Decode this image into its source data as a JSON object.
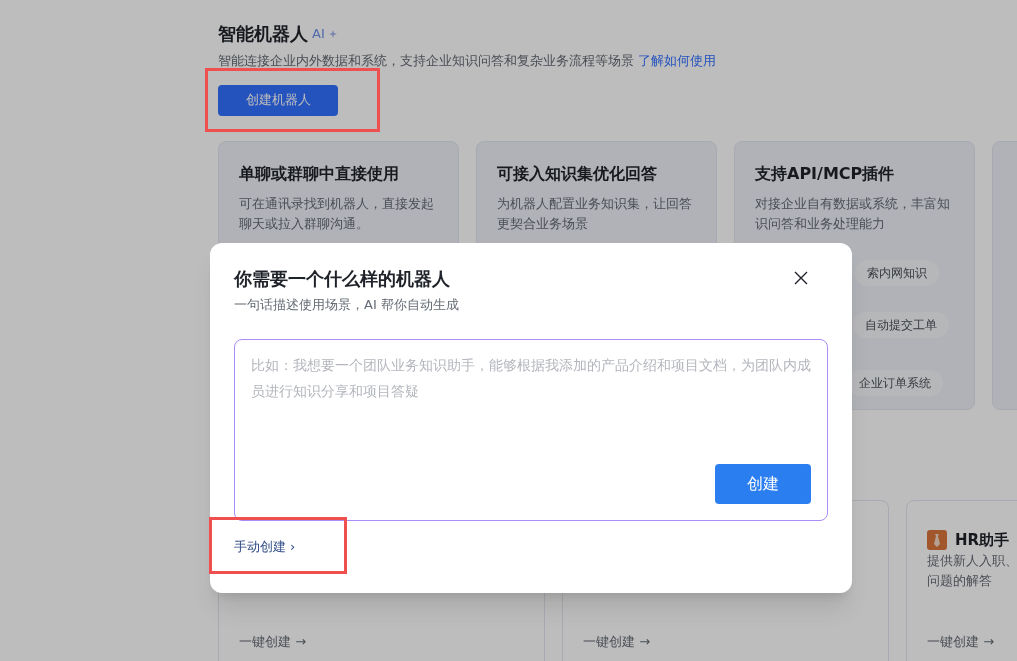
{
  "header": {
    "title": "智能机器人",
    "ai_badge": "AI",
    "description": "智能连接企业内外数据和系统，支持企业知识问答和复杂业务流程等场景",
    "learn_link": "了解如何使用",
    "create_button": "创建机器人"
  },
  "feature_cards": [
    {
      "title": "单聊或群聊中直接使用",
      "description": "可在通讯录找到机器人，直接发起聊天或拉入群聊沟通。"
    },
    {
      "title": "可接入知识集优化回答",
      "description": "为机器人配置业务知识集，让回答更契合业务场景"
    },
    {
      "title": "支持API/MCP插件",
      "description": "对接企业自有数据或系统，丰富知识问答和业务处理能力",
      "chips": [
        "索内网知识",
        "自动提交工单",
        "企业订单系统"
      ]
    }
  ],
  "template_cards": [
    {
      "action": "一键创建 →"
    },
    {
      "action": "一键创建 →"
    },
    {
      "title": "HR助手",
      "description_lines": [
        "提供新人入职、",
        "问题的解答"
      ],
      "action": "一键创建 →"
    }
  ],
  "dialog": {
    "title": "你需要一个什么样的机器人",
    "subtitle": "一句话描述使用场景，AI 帮你自动生成",
    "placeholder": "比如：我想要一个团队业务知识助手，能够根据我添加的产品介绍和项目文档，为团队内成员进行知识分享和项目答疑",
    "create_button": "创建",
    "manual_link": "手动创建",
    "manual_arrow": "›"
  }
}
